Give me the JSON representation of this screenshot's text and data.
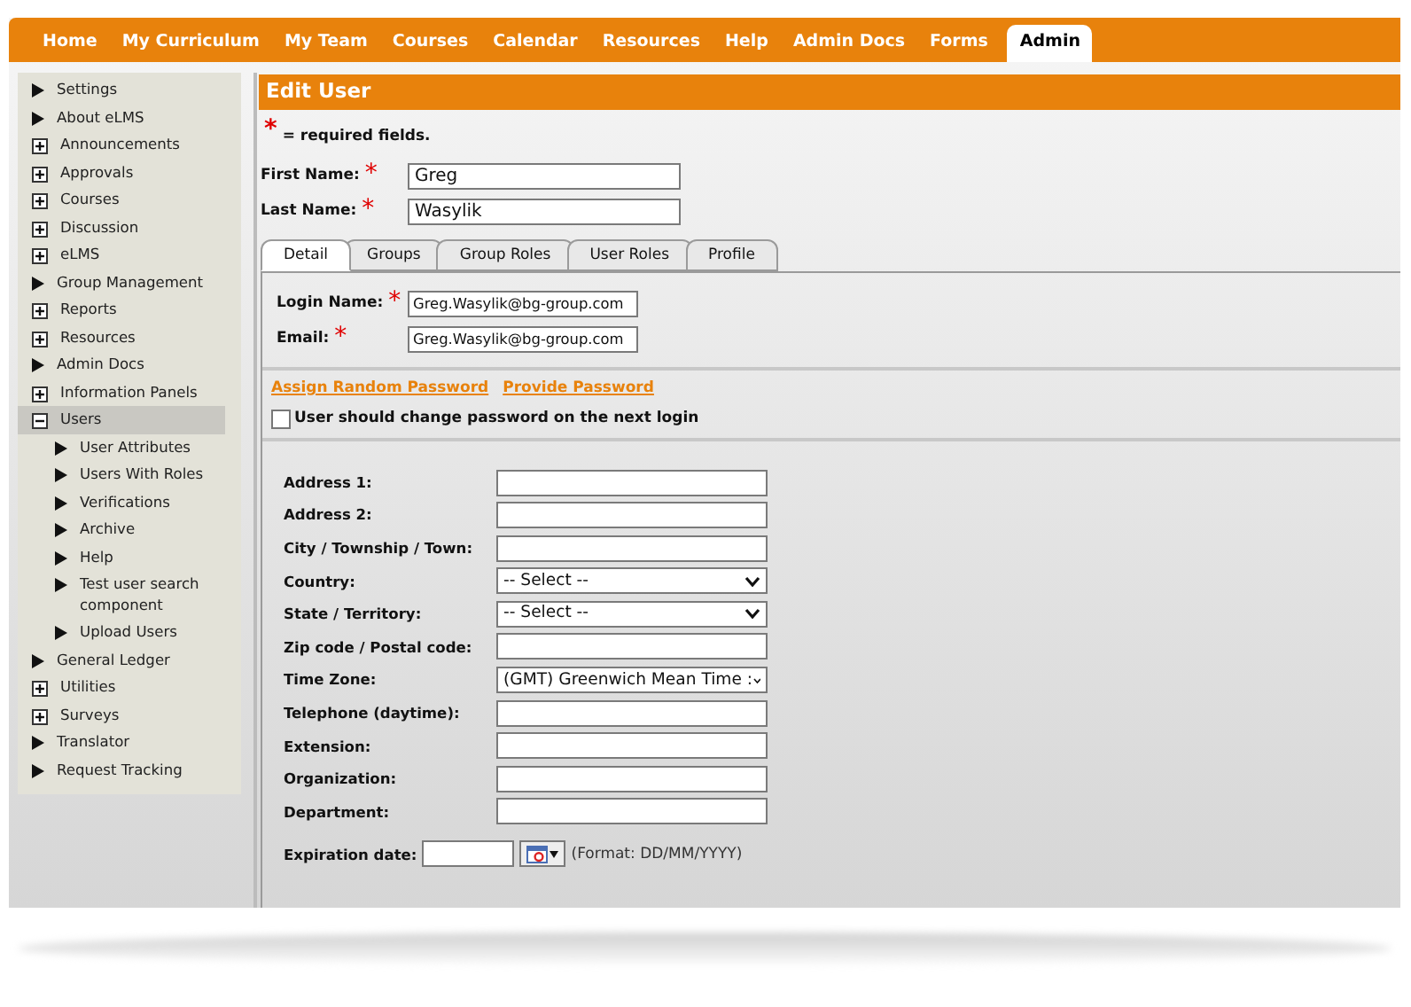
{
  "nav": [
    {
      "label": "Home",
      "selected": false
    },
    {
      "label": "My Curriculum",
      "selected": false
    },
    {
      "label": "My Team",
      "selected": false
    },
    {
      "label": "Courses",
      "selected": false
    },
    {
      "label": "Calendar",
      "selected": false
    },
    {
      "label": "Resources",
      "selected": false
    },
    {
      "label": "Help",
      "selected": false
    },
    {
      "label": "Admin Docs",
      "selected": false
    },
    {
      "label": "Forms",
      "selected": false
    },
    {
      "label": "Admin",
      "selected": true
    }
  ],
  "sidebar": {
    "items": [
      {
        "label": "Settings",
        "kind": "arrow",
        "selected": false
      },
      {
        "label": "About eLMS",
        "kind": "arrow",
        "selected": false
      },
      {
        "label": "Announcements",
        "kind": "group",
        "expanded": false,
        "selected": false
      },
      {
        "label": "Approvals",
        "kind": "group",
        "expanded": false,
        "selected": false
      },
      {
        "label": "Courses",
        "kind": "group",
        "expanded": false,
        "selected": false
      },
      {
        "label": "Discussion",
        "kind": "group",
        "expanded": false,
        "selected": false
      },
      {
        "label": "eLMS",
        "kind": "group",
        "expanded": false,
        "selected": false
      },
      {
        "label": "Group Management",
        "kind": "arrow",
        "selected": false
      },
      {
        "label": "Reports",
        "kind": "group",
        "expanded": false,
        "selected": false
      },
      {
        "label": "Resources",
        "kind": "group",
        "expanded": false,
        "selected": false
      },
      {
        "label": "Admin Docs",
        "kind": "arrow",
        "selected": false
      },
      {
        "label": "Information Panels",
        "kind": "group",
        "expanded": false,
        "selected": false
      },
      {
        "label": "Users",
        "kind": "group",
        "expanded": true,
        "selected": true,
        "children": [
          {
            "label": "User Attributes",
            "kind": "arrow",
            "selected": false
          },
          {
            "label": "Users With Roles",
            "kind": "arrow",
            "selected": false
          },
          {
            "label": "Verifications",
            "kind": "arrow",
            "selected": false
          },
          {
            "label": "Archive",
            "kind": "arrow",
            "selected": false
          },
          {
            "label": "Help",
            "kind": "arrow",
            "selected": false
          },
          {
            "label": "Test user search component",
            "kind": "arrow",
            "selected": false
          },
          {
            "label": "Upload Users",
            "kind": "arrow",
            "selected": false
          }
        ]
      },
      {
        "label": "General Ledger",
        "kind": "arrow",
        "selected": false
      },
      {
        "label": "Utilities",
        "kind": "group",
        "expanded": false,
        "selected": false
      },
      {
        "label": "Surveys",
        "kind": "group",
        "expanded": false,
        "selected": false
      },
      {
        "label": "Translator",
        "kind": "arrow",
        "selected": false
      },
      {
        "label": "Request Tracking",
        "kind": "arrow",
        "selected": false
      }
    ]
  },
  "panel": {
    "title": "Edit User",
    "required_mark": "*",
    "required_note": "= required fields."
  },
  "name_fields": [
    {
      "label": "First Name:",
      "value": "Greg",
      "required": true
    },
    {
      "label": "Last Name:",
      "value": "Wasylik",
      "required": true
    }
  ],
  "tabs": [
    {
      "label": "Detail",
      "selected": true
    },
    {
      "label": "Groups",
      "selected": false
    },
    {
      "label": "Group Roles",
      "selected": false
    },
    {
      "label": "User Roles",
      "selected": false
    },
    {
      "label": "Profile",
      "selected": false
    }
  ],
  "login_fields": [
    {
      "label": "Login Name:",
      "value": "Greg.Wasylik@bg-group.com",
      "required": true
    },
    {
      "label": "Email:",
      "value": "Greg.Wasylik@bg-group.com",
      "required": true
    }
  ],
  "password_links": [
    "Assign Random Password",
    "Provide Password"
  ],
  "change_password": {
    "label": "User should change password on the next login",
    "checked": false
  },
  "address_fields": [
    {
      "label": "Address 1:",
      "kind": "text"
    },
    {
      "label": "Address 2:",
      "kind": "text"
    },
    {
      "label": "City / Township / Town:",
      "kind": "text"
    },
    {
      "label": "Country:",
      "kind": "select",
      "value": "-- Select --"
    },
    {
      "label": "State / Territory:",
      "kind": "select",
      "value": "-- Select --"
    },
    {
      "label": "Zip code / Postal code:",
      "kind": "text"
    },
    {
      "label": "Time Zone:",
      "kind": "select",
      "value": "(GMT) Greenwich Mean Time :"
    },
    {
      "label": "Telephone (daytime):",
      "kind": "text"
    },
    {
      "label": "Extension:",
      "kind": "text"
    },
    {
      "label": "Organization:",
      "kind": "text"
    },
    {
      "label": "Department:",
      "kind": "text"
    }
  ],
  "expiration": {
    "label": "Expiration date:",
    "format": "(Format: DD/MM/YYYY)"
  }
}
